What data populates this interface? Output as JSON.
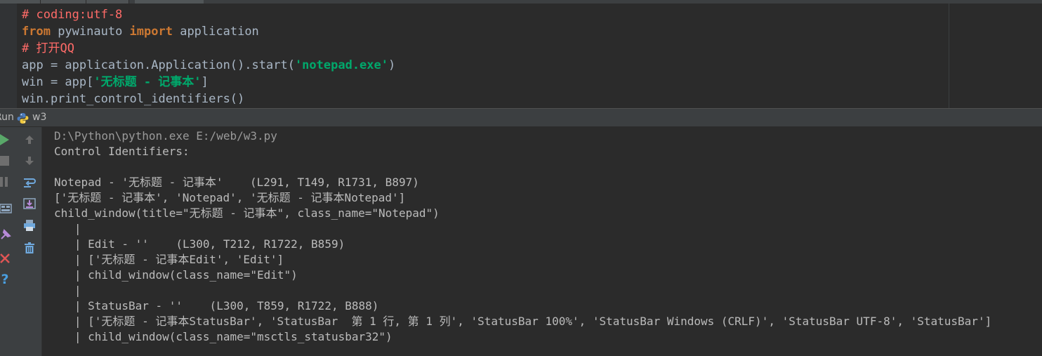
{
  "editor": {
    "lines": [
      [
        {
          "cls": "cm",
          "text": "# coding:utf-8"
        }
      ],
      [
        {
          "cls": "kw",
          "text": "from"
        },
        {
          "cls": "",
          "text": " pywinauto "
        },
        {
          "cls": "kw",
          "text": "import"
        },
        {
          "cls": "",
          "text": " application"
        }
      ],
      [
        {
          "cls": "cm",
          "text": "# 打开QQ"
        }
      ],
      [
        {
          "cls": "",
          "text": "app = application.Application().start("
        },
        {
          "cls": "st",
          "text": "'notepad.exe'"
        },
        {
          "cls": "",
          "text": ")"
        }
      ],
      [
        {
          "cls": "",
          "text": "win = app["
        },
        {
          "cls": "st",
          "text": "'无标题 - 记事本'"
        },
        {
          "cls": "",
          "text": "]"
        }
      ],
      [
        {
          "cls": "",
          "text": "win.print_control_identifiers()"
        }
      ]
    ]
  },
  "run": {
    "tab_label": "Run",
    "config_name": "w3"
  },
  "console": {
    "lines": [
      "D:\\Python\\python.exe E:/web/w3.py",
      "Control Identifiers:",
      "",
      "Notepad - '无标题 - 记事本'    (L291, T149, R1731, B897)",
      "['无标题 - 记事本', 'Notepad', '无标题 - 记事本Notepad']",
      "child_window(title=\"无标题 - 记事本\", class_name=\"Notepad\")",
      "   |",
      "   | Edit - ''    (L300, T212, R1722, B859)",
      "   | ['无标题 - 记事本Edit', 'Edit']",
      "   | child_window(class_name=\"Edit\")",
      "   |",
      "   | StatusBar - ''    (L300, T859, R1722, B888)",
      "   | ['无标题 - 记事本StatusBar', 'StatusBar  第 1 行, 第 1 列', 'StatusBar 100%', 'StatusBar Windows (CRLF)', 'StatusBar UTF-8', 'StatusBar']",
      "   | child_window(class_name=\"msctls_statusbar32\")"
    ]
  },
  "colors": {
    "background": "#2b2b2b",
    "panel": "#3c3f41",
    "keyword": "#cc7832",
    "comment": "#ff6b68",
    "string": "#00a86b",
    "text": "#a9b7c6",
    "console_text": "#bbbbbb",
    "run_green": "#59a869",
    "close_red": "#e05555",
    "help_blue": "#4a9fe0"
  },
  "icons": {
    "run": "run-icon",
    "stop": "stop-icon",
    "pause": "pause-icon",
    "up": "arrow-up-icon",
    "down": "arrow-down-icon",
    "wrap": "soft-wrap-icon",
    "scroll": "scroll-to-end-icon",
    "print": "print-icon",
    "trash": "trash-icon",
    "close": "close-icon",
    "help": "help-icon"
  }
}
